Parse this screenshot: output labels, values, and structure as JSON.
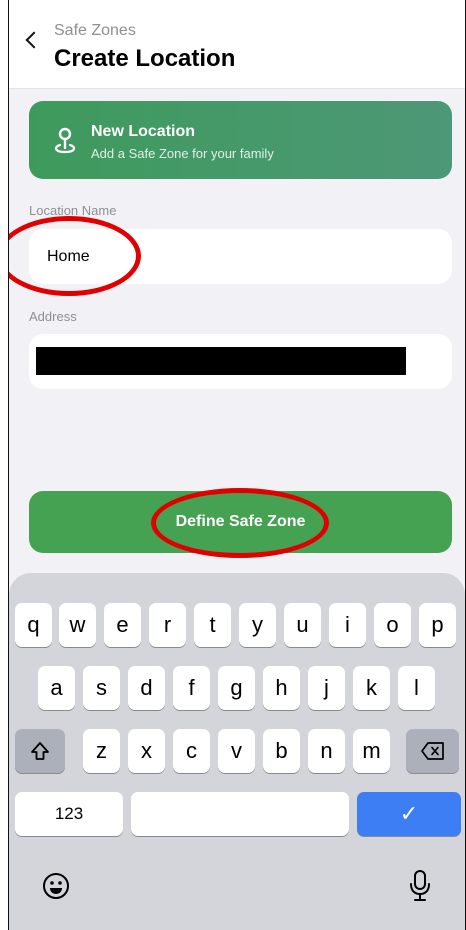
{
  "header": {
    "breadcrumb": "Safe Zones",
    "title": "Create Location"
  },
  "banner": {
    "title": "New Location",
    "subtitle": "Add a Safe Zone for your family",
    "gradient_start": "#3e9a5c",
    "gradient_end": "#4d9877"
  },
  "form": {
    "name_label": "Location Name",
    "name_value": "Home",
    "address_label": "Address",
    "address_value": ""
  },
  "primary_button": {
    "label": "Define Safe Zone",
    "color": "#46a253"
  },
  "annotation_color": "#e00000",
  "keyboard": {
    "row1": [
      "q",
      "w",
      "e",
      "r",
      "t",
      "y",
      "u",
      "i",
      "o",
      "p"
    ],
    "row2": [
      "a",
      "s",
      "d",
      "f",
      "g",
      "h",
      "j",
      "k",
      "l"
    ],
    "row3": [
      "z",
      "x",
      "c",
      "v",
      "b",
      "n",
      "m"
    ],
    "numbers_key": "123",
    "done_key": "✓",
    "shift_icon": "shift-icon",
    "delete_icon": "backspace-icon",
    "emoji_icon": "emoji-icon",
    "mic_icon": "microphone-icon",
    "done_color": "#3d7ef5"
  }
}
